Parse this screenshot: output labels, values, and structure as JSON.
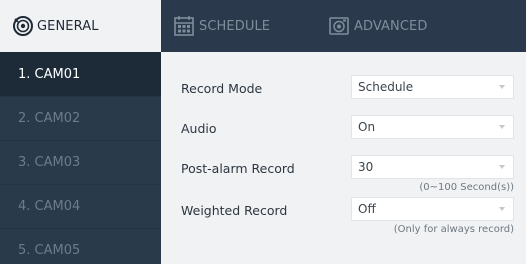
{
  "tabs": {
    "general": {
      "label": "GENERAL",
      "icon": "camera-lens-icon"
    },
    "schedule": {
      "label": "SCHEDULE",
      "icon": "calendar-icon"
    },
    "advanced": {
      "label": "ADVANCED",
      "icon": "camera-settings-icon"
    }
  },
  "cameras": [
    {
      "label": "1. CAM01"
    },
    {
      "label": "2. CAM02"
    },
    {
      "label": "3. CAM03"
    },
    {
      "label": "4. CAM04"
    },
    {
      "label": "5. CAM05"
    }
  ],
  "form": {
    "record_mode": {
      "label": "Record Mode",
      "value": "Schedule"
    },
    "audio": {
      "label": "Audio",
      "value": "On"
    },
    "post_alarm": {
      "label": "Post-alarm Record",
      "value": "30",
      "hint": "(0~100 Second(s))"
    },
    "weighted": {
      "label": "Weighted Record",
      "value": "Off",
      "hint": "(Only for always record)"
    }
  },
  "colors": {
    "sidebar_bg": "#293a4b",
    "selected_bg": "#1d2b39",
    "content_bg": "#f0f2f4",
    "inactive_text": "#6d7c8b"
  }
}
